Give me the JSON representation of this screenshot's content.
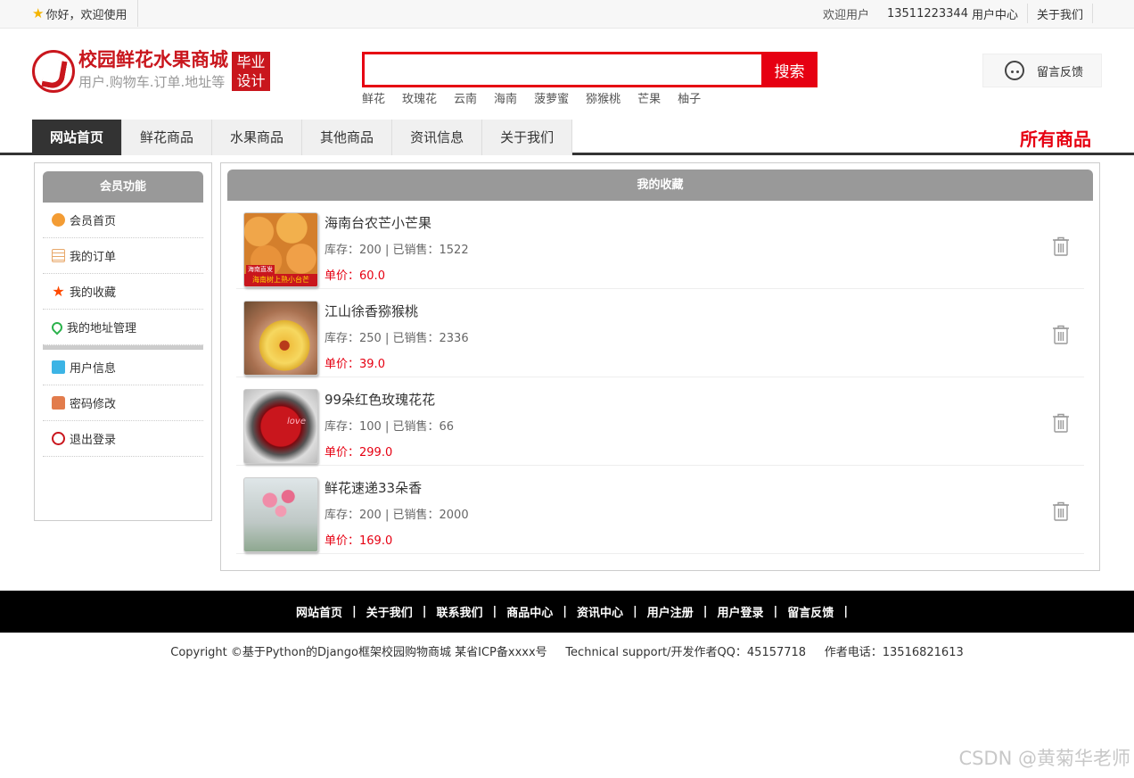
{
  "topbar": {
    "greeting": "你好，欢迎使用",
    "welcome_label": "欢迎用户",
    "user_phone": "13511223344",
    "user_center": "用户中心",
    "about": "关于我们"
  },
  "brand": {
    "title": "校园鲜花水果商城",
    "subtitle": "用户.购物车.订单.地址等",
    "badge_line1": "毕业",
    "badge_line2": "设计"
  },
  "search": {
    "value": "",
    "button": "搜索",
    "hotwords": [
      "鲜花",
      "玫瑰花",
      "云南",
      "海南",
      "菠萝蜜",
      "猕猴桃",
      "芒果",
      "柚子"
    ]
  },
  "feedback": {
    "label": "留言反馈"
  },
  "nav": {
    "items": [
      "网站首页",
      "鲜花商品",
      "水果商品",
      "其他商品",
      "资讯信息",
      "关于我们"
    ],
    "active_index": 0,
    "all_goods": "所有商品"
  },
  "sidebar": {
    "title": "会员功能",
    "group1": [
      {
        "label": "会员首页",
        "icon": "home-icon"
      },
      {
        "label": "我的订单",
        "icon": "order-icon"
      },
      {
        "label": "我的收藏",
        "icon": "star-icon"
      },
      {
        "label": "我的地址管理",
        "icon": "location-icon"
      }
    ],
    "group2": [
      {
        "label": "用户信息",
        "icon": "user-info-icon"
      },
      {
        "label": "密码修改",
        "icon": "lock-icon"
      },
      {
        "label": "退出登录",
        "icon": "power-icon"
      }
    ]
  },
  "favorites": {
    "title": "我的收藏",
    "stock_prefix": "库存：",
    "sold_prefix": " | 已销售：",
    "price_prefix": "单价：",
    "items": [
      {
        "name": "海南台农芒小芒果",
        "stock": "200",
        "sold": "1522",
        "price": "60.0",
        "thumb_text": "海南树上熟小台芒",
        "thumb_tag": "海南直发"
      },
      {
        "name": "江山徐香猕猴桃",
        "stock": "250",
        "sold": "2336",
        "price": "39.0"
      },
      {
        "name": "99朵红色玫瑰花花",
        "stock": "100",
        "sold": "66",
        "price": "299.0",
        "thumb_text": "love"
      },
      {
        "name": "鲜花速递33朵香",
        "stock": "200",
        "sold": "2000",
        "price": "169.0"
      }
    ]
  },
  "footer": {
    "links": [
      "网站首页",
      "关于我们",
      "联系我们",
      "商品中心",
      "资讯中心",
      "用户注册",
      "用户登录",
      "留言反馈"
    ],
    "copyright": "Copyright ©基于Python的Django框架校园购物商城 某省ICP备xxxx号",
    "support": "Technical support/开发作者QQ：45157718",
    "phone": "作者电话：13516821613"
  },
  "watermark": "CSDN @黄菊华老师"
}
